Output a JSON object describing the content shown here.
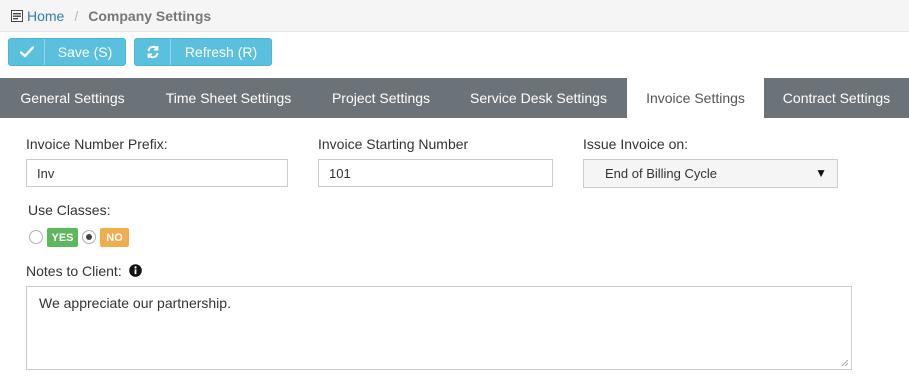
{
  "breadcrumb": {
    "home_label": "Home",
    "separator": "/",
    "current": "Company Settings"
  },
  "toolbar": {
    "save_label": "Save (S)",
    "refresh_label": "Refresh (R)"
  },
  "tabs": [
    {
      "label": "General Settings",
      "active": false
    },
    {
      "label": "Time Sheet Settings",
      "active": false
    },
    {
      "label": "Project Settings",
      "active": false
    },
    {
      "label": "Service Desk Settings",
      "active": false
    },
    {
      "label": "Invoice Settings",
      "active": true
    },
    {
      "label": "Contract Settings",
      "active": false
    }
  ],
  "form": {
    "prefix_label": "Invoice Number Prefix:",
    "prefix_value": "Inv",
    "starting_label": "Invoice Starting Number",
    "starting_value": "101",
    "issue_label": "Issue Invoice on:",
    "issue_value": "End of Billing Cycle",
    "classes_label": "Use Classes:",
    "yes_label": "YES",
    "no_label": "NO",
    "classes_selected": "NO",
    "notes_label": "Notes to Client:",
    "notes_value": "We appreciate our partnership."
  },
  "colors": {
    "accent": "#5bc0de",
    "tab_bar": "#6b7378",
    "yes": "#5cb85c",
    "no": "#f0ad4e",
    "link": "#337ab7"
  },
  "icons": {
    "home": "home-icon",
    "save": "check-icon",
    "refresh": "refresh-icon",
    "info": "info-icon",
    "dropdown": "caret-down-icon"
  }
}
